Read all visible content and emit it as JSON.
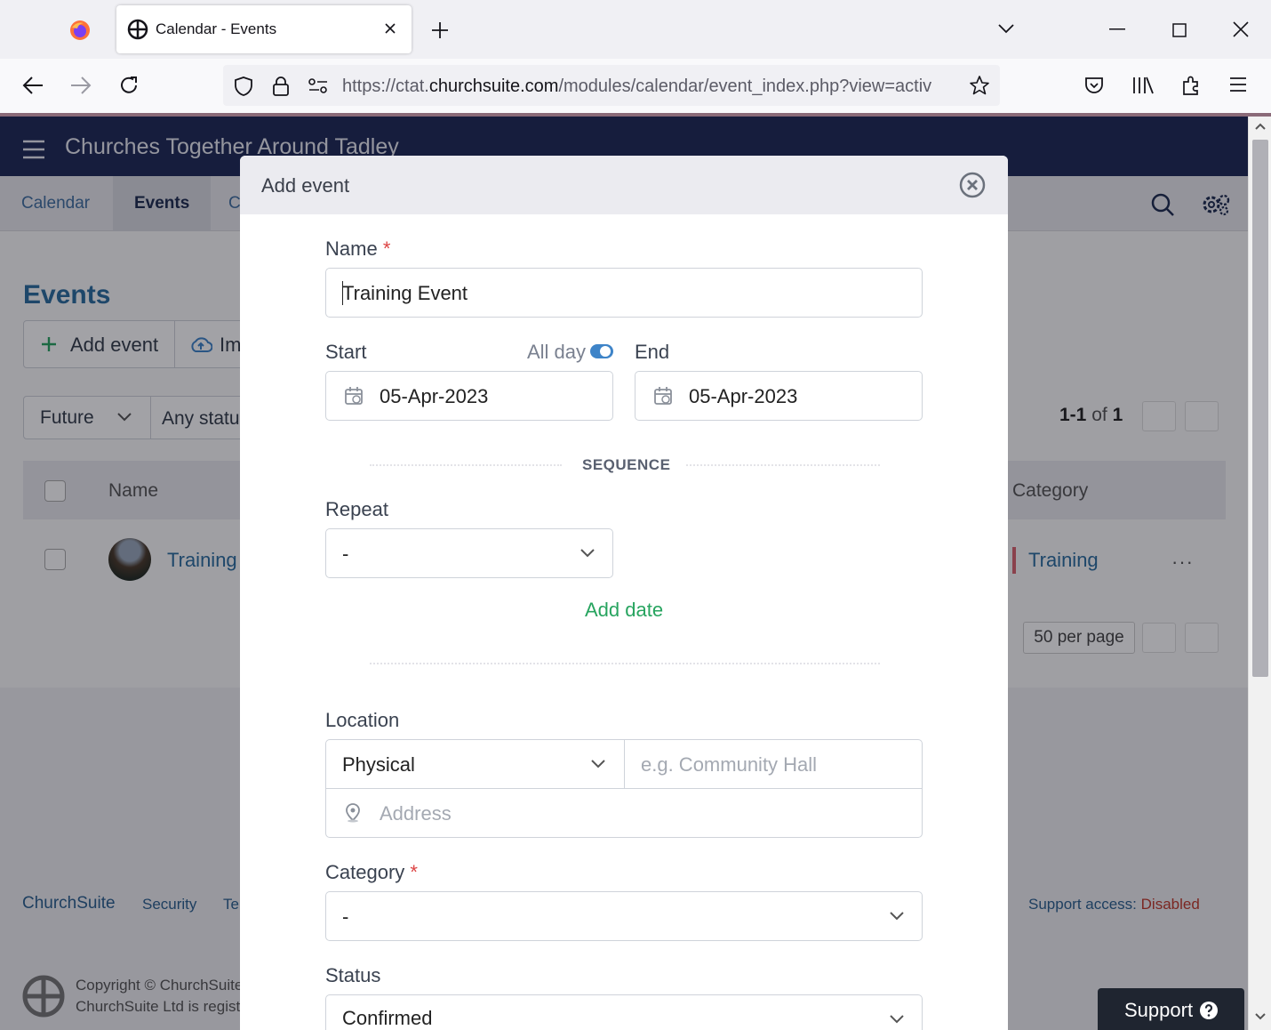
{
  "browser": {
    "tab_title": "Calendar - Events",
    "url_prefix": "https://ctat.",
    "url_domain": "churchsuite.com",
    "url_path": "/modules/calendar/event_index.php?view=activ"
  },
  "app": {
    "org_name": "Churches Together Around Tadley",
    "subnav": [
      "Calendar",
      "Events",
      "C"
    ],
    "events_heading": "Events",
    "add_event_label": "Add event",
    "import_label": "Im",
    "filter_future": "Future",
    "filter_status": "Any statu",
    "pager": {
      "range": "1-1",
      "of_label": "of",
      "total": "1"
    },
    "table_headers": {
      "name": "Name",
      "category": "Category"
    },
    "row": {
      "name": "Training",
      "category": "Training",
      "more": "···"
    },
    "per_page": "50 per page",
    "footer": {
      "brand": "ChurchSuite",
      "security": "Security",
      "terms": "Te",
      "support_access_label": "Support access:",
      "support_access_value": "Disabled",
      "copyright_line1": "Copyright © ChurchSuite",
      "copyright_line2": "ChurchSuite Ltd is regist"
    },
    "support_button": "Support"
  },
  "modal": {
    "title": "Add event",
    "name_label": "Name",
    "required_mark": "*",
    "name_value": "Training Event",
    "start_label": "Start",
    "allday_label": "All day",
    "allday_on": true,
    "end_label": "End",
    "start_date": "05-Apr-2023",
    "end_date": "05-Apr-2023",
    "sequence_label": "SEQUENCE",
    "repeat_label": "Repeat",
    "repeat_value": "-",
    "add_date_label": "Add date",
    "location_label": "Location",
    "location_type": "Physical",
    "location_name_placeholder": "e.g. Community Hall",
    "address_placeholder": "Address",
    "category_label": "Category",
    "category_value": "-",
    "status_label": "Status",
    "status_value": "Confirmed"
  },
  "colors": {
    "header_navy": "#1e2956",
    "link_blue": "#2a6c9f",
    "add_date_green": "#27a45f",
    "required_red": "#d44",
    "toggle_blue": "#3e84c8"
  },
  "icons": [
    "firefox-logo-icon",
    "churchsuite-favicon-icon",
    "close-icon",
    "plus-icon",
    "chevron-down-icon",
    "back-arrow-icon",
    "forward-arrow-icon",
    "reload-icon",
    "shield-icon",
    "lock-icon",
    "permissions-icon",
    "star-icon",
    "pocket-icon",
    "library-icon",
    "extensions-icon",
    "menu-icon",
    "search-icon",
    "settings-gear-icon",
    "calendar-icon",
    "map-pin-icon",
    "question-icon"
  ]
}
